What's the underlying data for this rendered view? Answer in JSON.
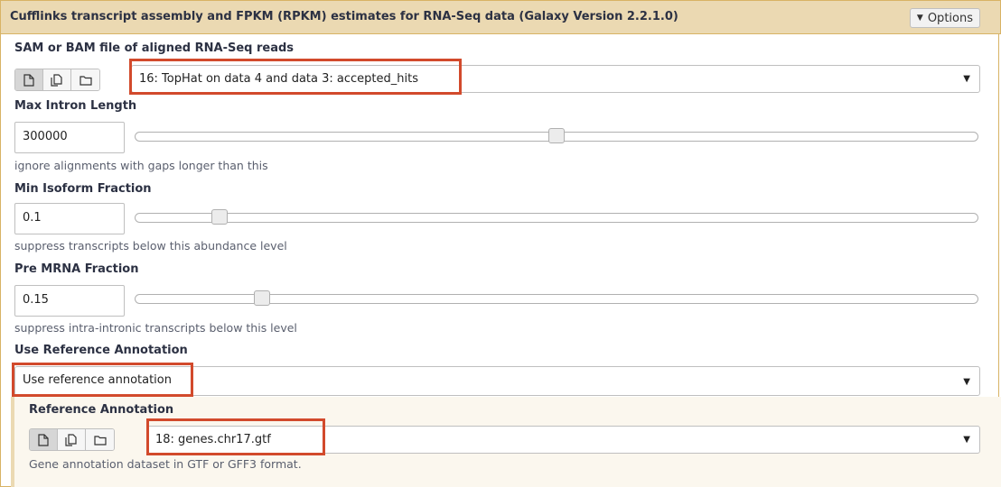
{
  "header": {
    "title": "Cufflinks transcript assembly and FPKM (RPKM) estimates for RNA-Seq data (Galaxy Version 2.2.1.0)",
    "options_label": "Options"
  },
  "bam_input": {
    "label": "SAM or BAM file of aligned RNA-Seq reads",
    "selected": "16: TopHat on data 4 and data 3: accepted_hits"
  },
  "max_intron": {
    "label": "Max Intron Length",
    "value": "300000",
    "help": "ignore alignments with gaps longer than this",
    "slider_fraction": 0.5
  },
  "min_isoform": {
    "label": "Min Isoform Fraction",
    "value": "0.1",
    "help": "suppress transcripts below this abundance level",
    "slider_fraction": 0.1
  },
  "pre_mrna": {
    "label": "Pre MRNA Fraction",
    "value": "0.15",
    "help": "suppress intra-intronic transcripts below this level",
    "slider_fraction": 0.15
  },
  "use_reference": {
    "label": "Use Reference Annotation",
    "selected": "Use reference annotation"
  },
  "reference_annotation": {
    "label": "Reference Annotation",
    "selected": "18: genes.chr17.gtf",
    "help": "Gene annotation dataset in GTF or GFF3 format."
  },
  "icons": [
    "file-icon",
    "files-icon",
    "folder-icon"
  ],
  "colors": {
    "header_bg": "#ebd9b2",
    "highlight": "#d24a2c",
    "border": "#d8b365"
  }
}
